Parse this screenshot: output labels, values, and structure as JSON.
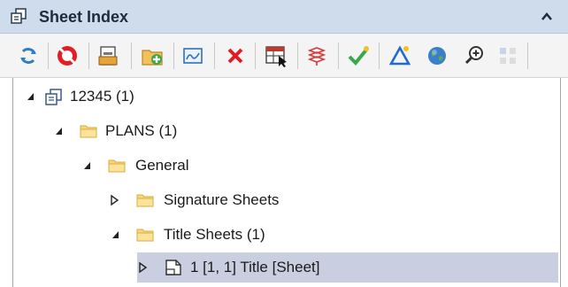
{
  "panel": {
    "title": "Sheet Index"
  },
  "toolbar": {
    "buttons": [
      {
        "icon": "refresh-icon"
      },
      {
        "icon": "no-stop-icon"
      },
      {
        "icon": "sheet-set-icon"
      },
      {
        "icon": "add-folder-icon"
      },
      {
        "icon": "map-view-icon"
      },
      {
        "icon": "delete-icon"
      },
      {
        "icon": "table-select-icon"
      },
      {
        "icon": "stack-icon"
      },
      {
        "icon": "checkmark-icon"
      },
      {
        "icon": "triangle-icon"
      },
      {
        "icon": "globe-icon"
      },
      {
        "icon": "zoom-icon"
      },
      {
        "icon": "grid-icon"
      }
    ]
  },
  "tree": {
    "nodes": [
      {
        "label": "12345 (1)",
        "expanded": true
      },
      {
        "label": "PLANS (1)",
        "expanded": true
      },
      {
        "label": "General",
        "expanded": true
      },
      {
        "label": "Signature Sheets",
        "expanded": false
      },
      {
        "label": "Title Sheets (1)",
        "expanded": true
      },
      {
        "label": "1 [1, 1] Title [Sheet]",
        "expanded": false,
        "selected": true
      }
    ]
  },
  "colors": {
    "header_bg": "#cfdcec",
    "selection_bg": "#c9cfe0",
    "folder": "#f6d77a"
  }
}
